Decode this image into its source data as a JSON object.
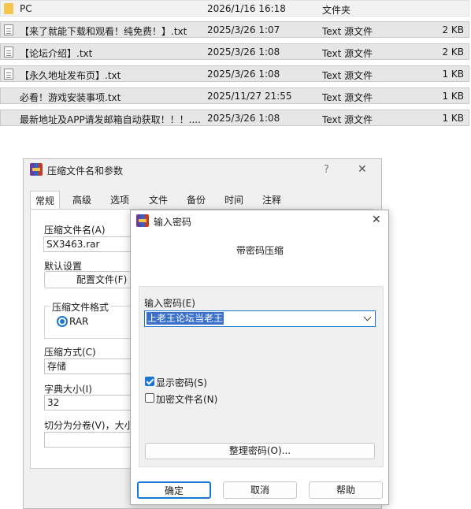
{
  "file_list": {
    "rows": [
      {
        "name": "PC",
        "date": "2026/1/16 16:18",
        "type": "文件夹",
        "size": "",
        "icon": "folder-icon"
      },
      {
        "name": "【来了就能下载和观看！纯免费！】.txt",
        "date": "2025/3/26 1:07",
        "type": "Text 源文件",
        "size": "2 KB",
        "icon": "text-file-icon"
      },
      {
        "name": "【论坛介绍】.txt",
        "date": "2025/3/26 1:08",
        "type": "Text 源文件",
        "size": "2 KB",
        "icon": "text-file-icon"
      },
      {
        "name": "【永久地址发布页】.txt",
        "date": "2025/3/26 1:08",
        "type": "Text 源文件",
        "size": "1 KB",
        "icon": "text-file-icon"
      },
      {
        "name": "必看！游戏安装事项.txt",
        "date": "2025/11/27 21:55",
        "type": "Text 源文件",
        "size": "1 KB",
        "icon": "text-file-icon"
      },
      {
        "name": "最新地址及APP请发邮箱自动获取！！！....",
        "date": "2025/3/26 1:08",
        "type": "Text 源文件",
        "size": "1 KB",
        "icon": "text-file-icon"
      }
    ]
  },
  "archive_dialog": {
    "title": "压缩文件名和参数",
    "help_glyph": "?",
    "close_glyph": "✕",
    "tabs": [
      "常规",
      "高级",
      "选项",
      "文件",
      "备份",
      "时间",
      "注释"
    ],
    "archive_name_label": "压缩文件名(A)",
    "archive_name_value": "SX3463.rar",
    "default_settings_label": "默认设置",
    "profiles_button": "配置文件(F)",
    "format_group_label": "压缩文件格式",
    "format_rar": "RAR",
    "method_label": "压缩方式(C)",
    "method_value": "存储",
    "dict_label": "字典大小(I)",
    "dict_value": "32",
    "split_label": "切分为分卷(V)，大小"
  },
  "password_dialog": {
    "title": "输入密码",
    "close_glyph": "✕",
    "heading": "带密码压缩",
    "enter_label": "输入密码(E)",
    "password_value": "上老王论坛当老王",
    "show_password": "显示密码(S)",
    "show_password_checked": true,
    "encrypt_names": "加密文件名(N)",
    "encrypt_names_checked": false,
    "organize_button": "整理密码(O)...",
    "ok_button": "确定",
    "cancel_button": "取消",
    "help_button": "帮助"
  },
  "colors": {
    "accent": "#1976d2",
    "selection": "#3b6fc9",
    "folder": "#f4c64e"
  }
}
